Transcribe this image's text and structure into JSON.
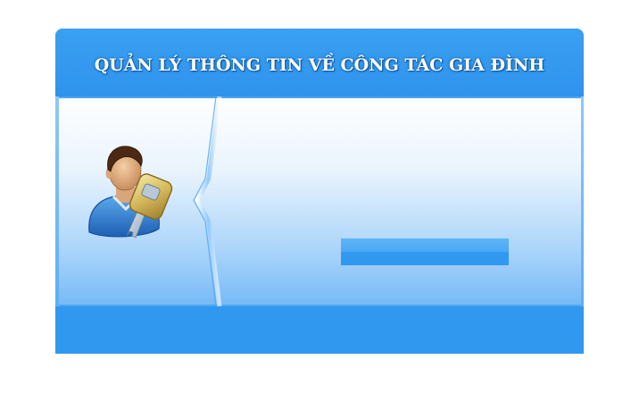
{
  "header": {
    "title": "QUẢN LÝ THÔNG TIN VỀ CÔNG TÁC GIA ĐÌNH"
  },
  "icons": {
    "user_key": "user-with-key-icon"
  },
  "colors": {
    "header_blue": "#3198f0",
    "footer_blue": "#3198f0",
    "title_text": "#ffffff",
    "body_gradient_top": "#ffffff",
    "body_gradient_bottom": "#76b9f6"
  }
}
